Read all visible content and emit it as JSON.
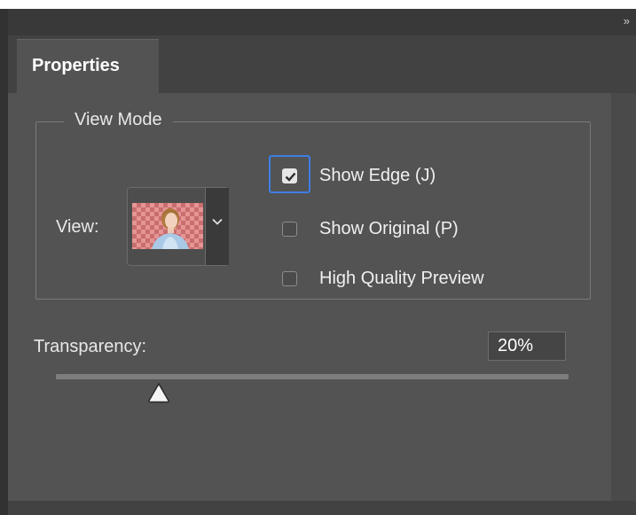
{
  "panel": {
    "collapse_label": "»",
    "tab_label": "Properties"
  },
  "view_mode": {
    "legend": "View Mode",
    "view_label": "View:",
    "thumbnail_icon": "image-thumbnail-icon",
    "dropdown_icon": "chevron-down-icon",
    "checkboxes": [
      {
        "label": "Show Edge (J)",
        "checked": true,
        "focused": true
      },
      {
        "label": "Show Original (P)",
        "checked": false,
        "focused": false
      },
      {
        "label": "High Quality Preview",
        "checked": false,
        "focused": false
      }
    ]
  },
  "transparency": {
    "label": "Transparency:",
    "value_text": "20%",
    "value": 20,
    "min": 0,
    "max": 100
  },
  "colors": {
    "panel_bg": "#535353",
    "focus_ring": "#3d7ee6",
    "text": "#e8e8e8"
  }
}
